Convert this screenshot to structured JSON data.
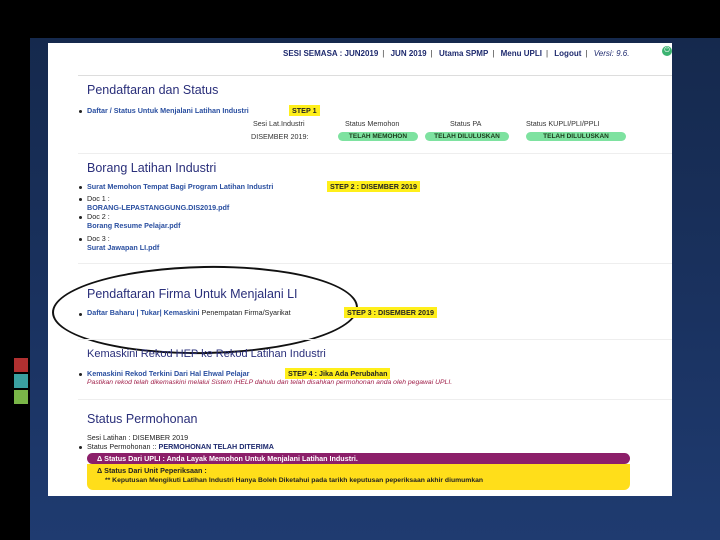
{
  "nav": {
    "sesi_label": "SESI SEMASA : JUN2019",
    "jun": "JUN 2019",
    "utama": "Utama SPMP",
    "menu": "Menu UPLI",
    "logout": "Logout",
    "versi": "Versi: 9.6."
  },
  "section1": {
    "title": "Pendaftaran dan Status",
    "link": "Daftar / Status Untuk Menjalani Latihan Industri",
    "step": "STEP 1",
    "col_headers": [
      "Sesi Lat.Industri",
      "Status Memohon",
      "Status PA",
      "Status KUPLI/PLI/PPLI"
    ],
    "date": "DISEMBER 2019:",
    "chips": [
      "TELAH MEMOHON",
      "TELAH DILULUSKAN",
      "TELAH DILULUSKAN"
    ]
  },
  "section2": {
    "title": "Borang Latihan Industri",
    "link": "Surat Memohon Tempat Bagi Program Latihan Industri",
    "step": "STEP 2 :   DISEMBER 2019",
    "doc1_label": "Doc 1 :",
    "doc1_file": "BORANG-LEPASTANGGUNG.DIS2019.pdf",
    "doc2_label": "Doc 2 :",
    "doc2_file": "Borang Resume Pelajar.pdf",
    "doc3_label": "Doc 3 :",
    "doc3_file": "Surat Jawapan LI.pdf"
  },
  "section3": {
    "title": "Pendaftaran Firma Untuk Menjalani LI",
    "link": "Daftar Baharu | Tukar| Kemaskini",
    "rest": "Penempatan Firma/Syarikat",
    "step": "STEP 3 : DISEMBER 2019"
  },
  "section4": {
    "title": "Kemaskini Rekod HEP ke Rekod Latihan Industri",
    "line": "Kemaskini Rekod Terkini Dari Hal Ehwal Pelajar",
    "step": "STEP 4 : Jika Ada Perubahan",
    "note": "Pastikan rekod telah dikemaskini melalui Sistem iHELP dahulu dan telah disahkan permohonan anda oleh pegawai UPLI."
  },
  "section5": {
    "title": "Status Permohonan",
    "sesi": "Sesi Latihan : DISEMBER 2019",
    "status_label": "Status Permohonan :: ",
    "status_value": "PERMOHONAN TELAH DITERIMA",
    "upli": "Δ Status Dari UPLI : Anda Layak Memohon Untuk Menjalani Latihan Industri.",
    "unit": "Δ Status Dari Unit Peperiksaan :",
    "note": "** Keputusan Mengikuti Latihan Industri Hanya Boleh Diketahui pada tarikh keputusan peperiksaan akhir diumumkan"
  }
}
